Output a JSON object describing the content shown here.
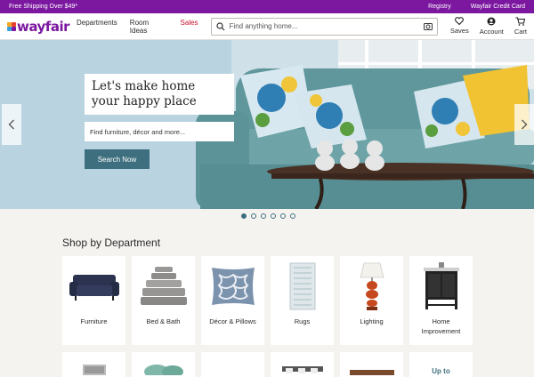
{
  "promo": {
    "text": "Free Shipping Over $49*",
    "registry": "Registry",
    "credit_card": "Wayfair Credit Card"
  },
  "header": {
    "logo": "wayfair",
    "nav": [
      {
        "label": "Departments"
      },
      {
        "label": "Room Ideas"
      },
      {
        "label": "Sales"
      }
    ],
    "search_placeholder": "Find anything home...",
    "account": {
      "saves": "Saves",
      "account": "Account",
      "cart": "Cart"
    }
  },
  "hero": {
    "headline_1": "Let's make home",
    "headline_2": "your happy place",
    "input_placeholder": "Find furniture, décor and more...",
    "button": "Search Now",
    "slides": 6
  },
  "shop": {
    "title": "Shop by Department",
    "departments": [
      {
        "label": "Furniture",
        "icon": "sofa-icon"
      },
      {
        "label": "Bed & Bath",
        "icon": "towels-icon"
      },
      {
        "label": "Décor & Pillows",
        "icon": "pillow-icon"
      },
      {
        "label": "Rugs",
        "icon": "rug-icon"
      },
      {
        "label": "Lighting",
        "icon": "lamp-icon"
      },
      {
        "label": "Home Improvement",
        "icon": "vanity-icon"
      }
    ],
    "second_row_last": "Up to"
  },
  "colors": {
    "brand": "#7b189f",
    "button": "#3d6f7f",
    "sales": "#c8102e"
  }
}
